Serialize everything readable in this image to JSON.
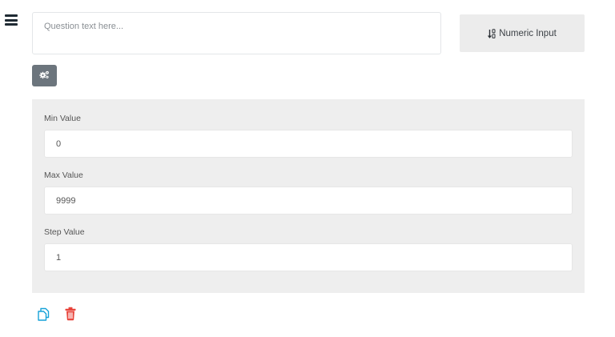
{
  "question": {
    "placeholder": "Question text here...",
    "value": ""
  },
  "type_button": {
    "label": "Numeric Input",
    "icon": "sort-numeric-icon"
  },
  "settings_button": {
    "icon": "cogs-icon"
  },
  "settings": {
    "min": {
      "label": "Min Value",
      "value": "0"
    },
    "max": {
      "label": "Max Value",
      "value": "9999"
    },
    "step": {
      "label": "Step Value",
      "value": "1"
    }
  },
  "actions": {
    "copy": {
      "icon": "copy-icon",
      "color": "#17a2d8"
    },
    "delete": {
      "icon": "trash-icon",
      "color": "#e8453c"
    }
  },
  "colors": {
    "panel_bg": "#eeeeee",
    "settings_button_bg": "#6c757d",
    "type_button_bg": "#ececec"
  }
}
